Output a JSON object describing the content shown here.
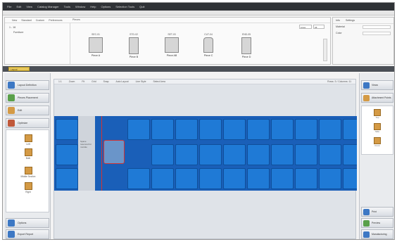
{
  "menu": [
    "File",
    "Edit",
    "View",
    "Catalog Manager",
    "Tools",
    "Window",
    "Help",
    "Options",
    "Selection Tools",
    "Quit"
  ],
  "catalog": {
    "tabs": [
      "New",
      "Standard",
      "Custom",
      "Preferences"
    ],
    "tree": [
      "1 - 16",
      "Furniture"
    ],
    "section_tab": "Pieces",
    "pieces": [
      {
        "code": "SEC-01",
        "name": "Piece A"
      },
      {
        "code": "STD-02",
        "name": "Piece B"
      },
      {
        "code": "SET-03",
        "name": "Piece AB"
      },
      {
        "code": "CUT-04",
        "name": "Piece C"
      },
      {
        "code": "END-05",
        "name": "Piece D"
      }
    ],
    "dropdown_1": "Lines",
    "dropdown_2": "All"
  },
  "properties": {
    "tabs": [
      "Info",
      "Settings"
    ],
    "rows": [
      {
        "label": "Material"
      },
      {
        "label": "Color"
      }
    ]
  },
  "dark_band": {
    "highlight": "Layout"
  },
  "left_sidebar": {
    "buttons": [
      "Layout Definition",
      "Pieces Placement",
      "Edit",
      "Optimize"
    ],
    "panel_items": [
      "Left",
      "Both",
      "Middle Section",
      "Right"
    ],
    "bottom_buttons": [
      "Options",
      "Export Report"
    ]
  },
  "main_toolbar": [
    "1:1",
    "Zoom",
    "Fit",
    "Grid",
    "Snap",
    "Auto Layout",
    "Line Style",
    "Select Area",
    "Rows: 3 / Columns: 11"
  ],
  "canvas": {
    "gap_label": "Space reserved for module"
  },
  "right_sidebar": {
    "top_buttons": [
      "Views",
      "Attachment Points"
    ],
    "panel_items": [
      "Top",
      "Side",
      "Front"
    ],
    "bottom_buttons": [
      "Print",
      "Preview",
      "Manufacturing"
    ]
  },
  "colors": {
    "tile": "#1f7ad6",
    "selection": "#d23434",
    "highlight": "#e8c85a"
  }
}
